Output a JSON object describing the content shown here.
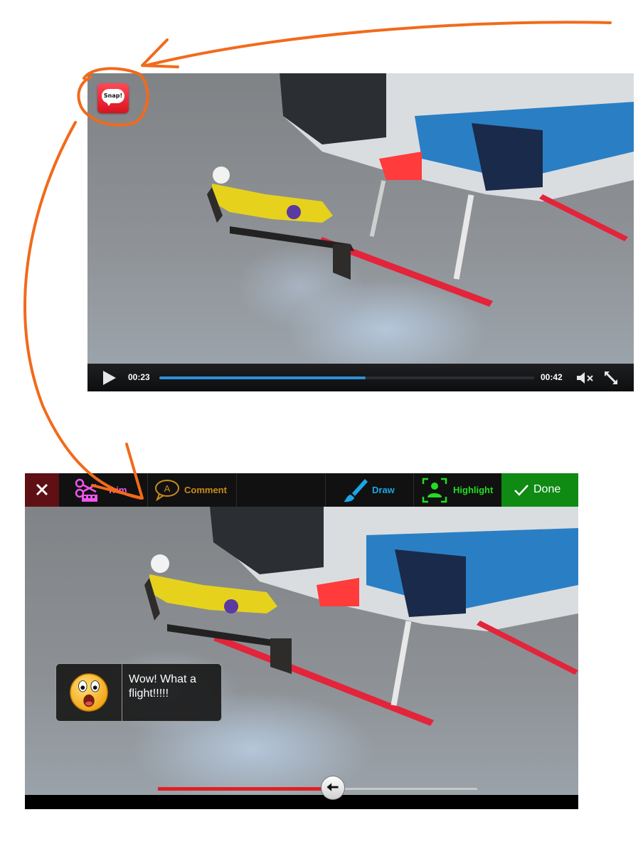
{
  "player": {
    "current_time": "00:23",
    "duration": "00:42",
    "progress_fraction": 0.55,
    "accent_color": "#2f8fd8",
    "snap_button_label": "Snap!"
  },
  "editor": {
    "toolbar": {
      "trim_label": "Trim",
      "comment_label": "Comment",
      "draw_label": "Draw",
      "highlight_label": "Highlight",
      "done_label": "Done"
    },
    "colors": {
      "trim": "#ee55ee",
      "comment": "#c98a1c",
      "draw": "#1aa7e8",
      "highlight": "#22dd22",
      "done_bg": "#0f8a13",
      "close_bg": "#5e1014"
    },
    "comment": {
      "emoji": "shocked-face",
      "text": "Wow! What a flight!!!!!"
    },
    "trim_position_fraction": 0.55
  },
  "annotation_color": "#f26a1b"
}
